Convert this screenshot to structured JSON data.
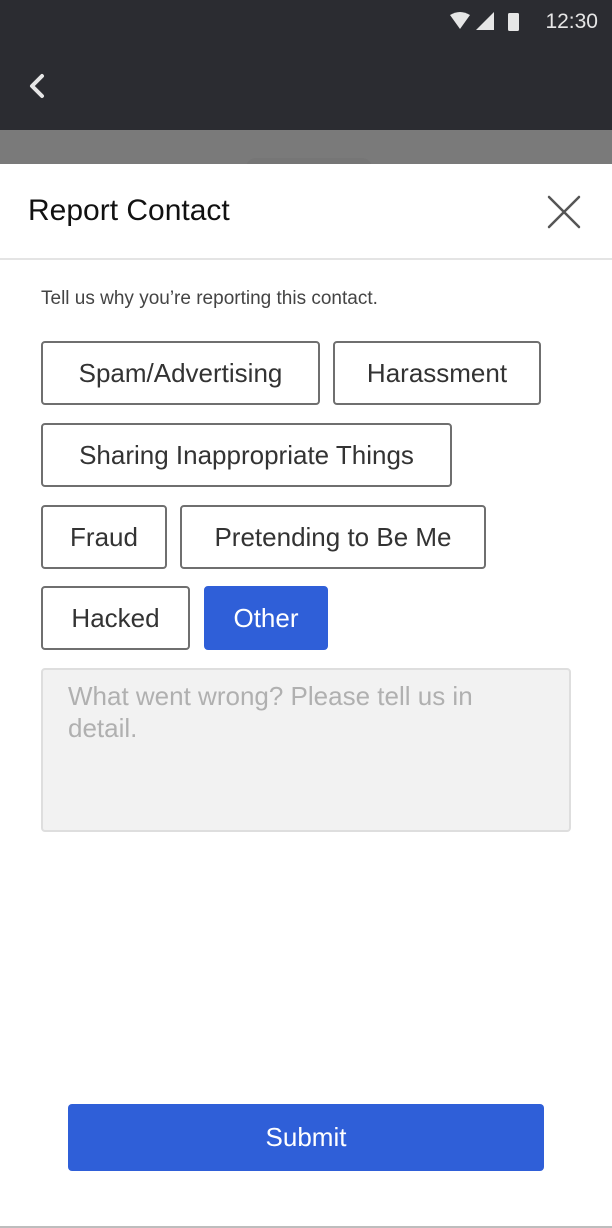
{
  "status_bar": {
    "time": "12:30",
    "icons": [
      "wifi-icon",
      "signal-icon",
      "battery-icon"
    ]
  },
  "app_bar": {
    "back_icon": "chevron-left-icon"
  },
  "sheet": {
    "title": "Report Contact",
    "close_icon": "close-icon",
    "prompt": "Tell us why you’re reporting this contact.",
    "reasons": [
      {
        "label": "Spam/Advertising",
        "selected": false
      },
      {
        "label": "Harassment",
        "selected": false
      },
      {
        "label": "Sharing Inappropriate Things",
        "selected": false
      },
      {
        "label": "Fraud",
        "selected": false
      },
      {
        "label": "Pretending to Be Me",
        "selected": false
      },
      {
        "label": "Hacked",
        "selected": false
      },
      {
        "label": "Other",
        "selected": true
      }
    ],
    "detail_input": {
      "value": "",
      "placeholder": "What went wrong? Please tell us in detail."
    },
    "submit_label": "Submit"
  },
  "colors": {
    "accent": "#2f5fd8",
    "dark_bar": "#2b2c31",
    "chip_border": "#6f6f6f",
    "input_bg": "#f2f2f2"
  }
}
